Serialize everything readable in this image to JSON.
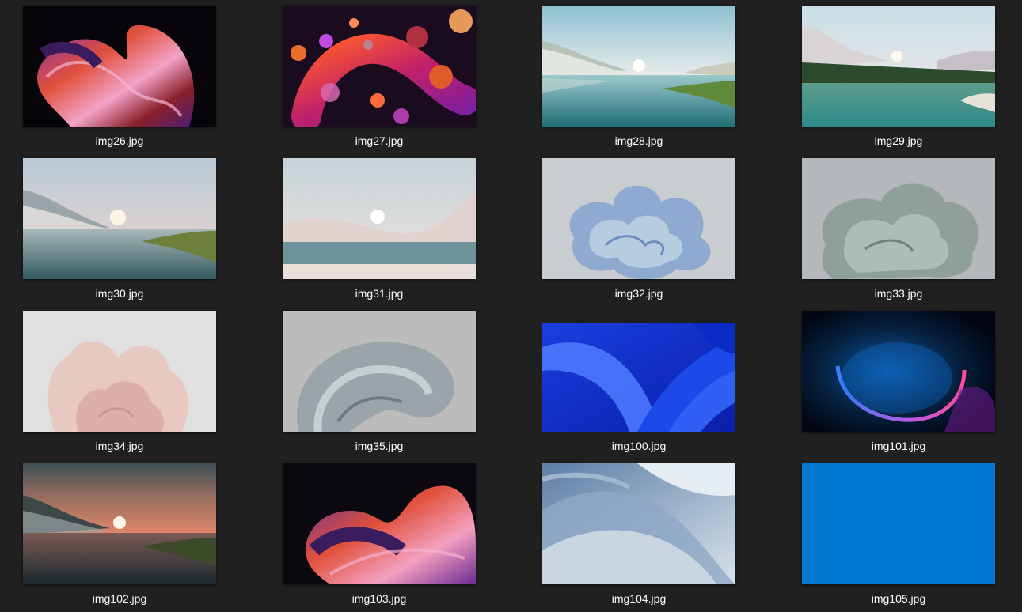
{
  "files": [
    {
      "name": "img26.jpg",
      "art": "ribbon-dark"
    },
    {
      "name": "img27.jpg",
      "art": "bubbles"
    },
    {
      "name": "img28.jpg",
      "art": "lake-day"
    },
    {
      "name": "img29.jpg",
      "art": "lake-forest"
    },
    {
      "name": "img30.jpg",
      "art": "lake-dusk"
    },
    {
      "name": "img31.jpg",
      "art": "dunes"
    },
    {
      "name": "img32.jpg",
      "art": "bloom-blue"
    },
    {
      "name": "img33.jpg",
      "art": "bloom-sage"
    },
    {
      "name": "img34.jpg",
      "art": "bloom-pink"
    },
    {
      "name": "img35.jpg",
      "art": "fold-grey"
    },
    {
      "name": "img100.jpg",
      "art": "bloom-windows-blue"
    },
    {
      "name": "img101.jpg",
      "art": "glow-orb"
    },
    {
      "name": "img102.jpg",
      "art": "lake-sunset"
    },
    {
      "name": "img103.jpg",
      "art": "ribbon-dark-2"
    },
    {
      "name": "img104.jpg",
      "art": "fold-light-blue"
    },
    {
      "name": "img105.jpg",
      "art": "solid-blue"
    }
  ],
  "colors": {
    "background": "#202020",
    "label": "#ffffff",
    "solid_wallpaper": "#0078d4"
  }
}
